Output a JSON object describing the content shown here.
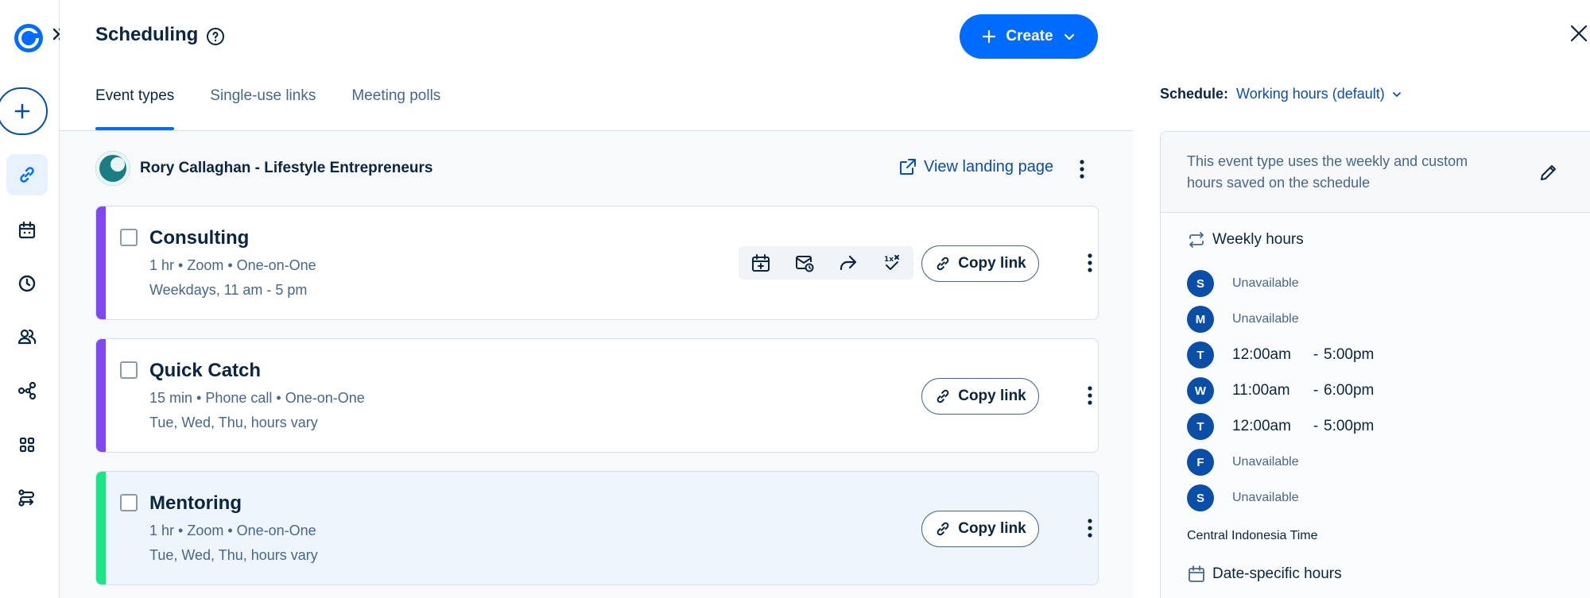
{
  "header": {
    "title": "Scheduling",
    "create_label": "Create"
  },
  "tabs": [
    {
      "label": "Event types",
      "active": true
    },
    {
      "label": "Single-use links",
      "active": false
    },
    {
      "label": "Meeting polls",
      "active": false
    }
  ],
  "owner": {
    "name": "Rory Callaghan - Lifestyle Entrepreneurs",
    "landing_label": "View landing page"
  },
  "events": [
    {
      "title": "Consulting",
      "meta": "1 hr • Zoom • One-on-One",
      "schedule": "Weekdays, 11 am - 5 pm",
      "color": "#8247f5",
      "copy_label": "Copy link"
    },
    {
      "title": "Quick Catch",
      "meta": "15 min • Phone call • One-on-One",
      "schedule": "Tue, Wed, Thu, hours vary",
      "color": "#8247f5",
      "copy_label": "Copy link"
    },
    {
      "title": "Mentoring",
      "meta": "1 hr • Zoom • One-on-One",
      "schedule": "Tue, Wed, Thu, hours vary",
      "color": "#17e885",
      "copy_label": "Copy link"
    }
  ],
  "panel": {
    "schedule_label": "Schedule:",
    "schedule_value": "Working hours (default)",
    "notice": "This event type uses the weekly and custom hours saved on the schedule",
    "weekly_label": "Weekly hours",
    "days": [
      {
        "letter": "S",
        "status": "Unavailable"
      },
      {
        "letter": "M",
        "status": "Unavailable"
      },
      {
        "letter": "T",
        "start": "12:00am",
        "end": "5:00pm"
      },
      {
        "letter": "W",
        "start": "11:00am",
        "end": "6:00pm"
      },
      {
        "letter": "T",
        "start": "12:00am",
        "end": "5:00pm"
      },
      {
        "letter": "F",
        "status": "Unavailable"
      },
      {
        "letter": "S",
        "status": "Unavailable"
      }
    ],
    "timezone": "Central Indonesia Time",
    "date_specific_label": "Date-specific hours"
  },
  "colors": {
    "brand": "#006bff",
    "navy": "#0a2540",
    "link": "#0a4ea8"
  }
}
